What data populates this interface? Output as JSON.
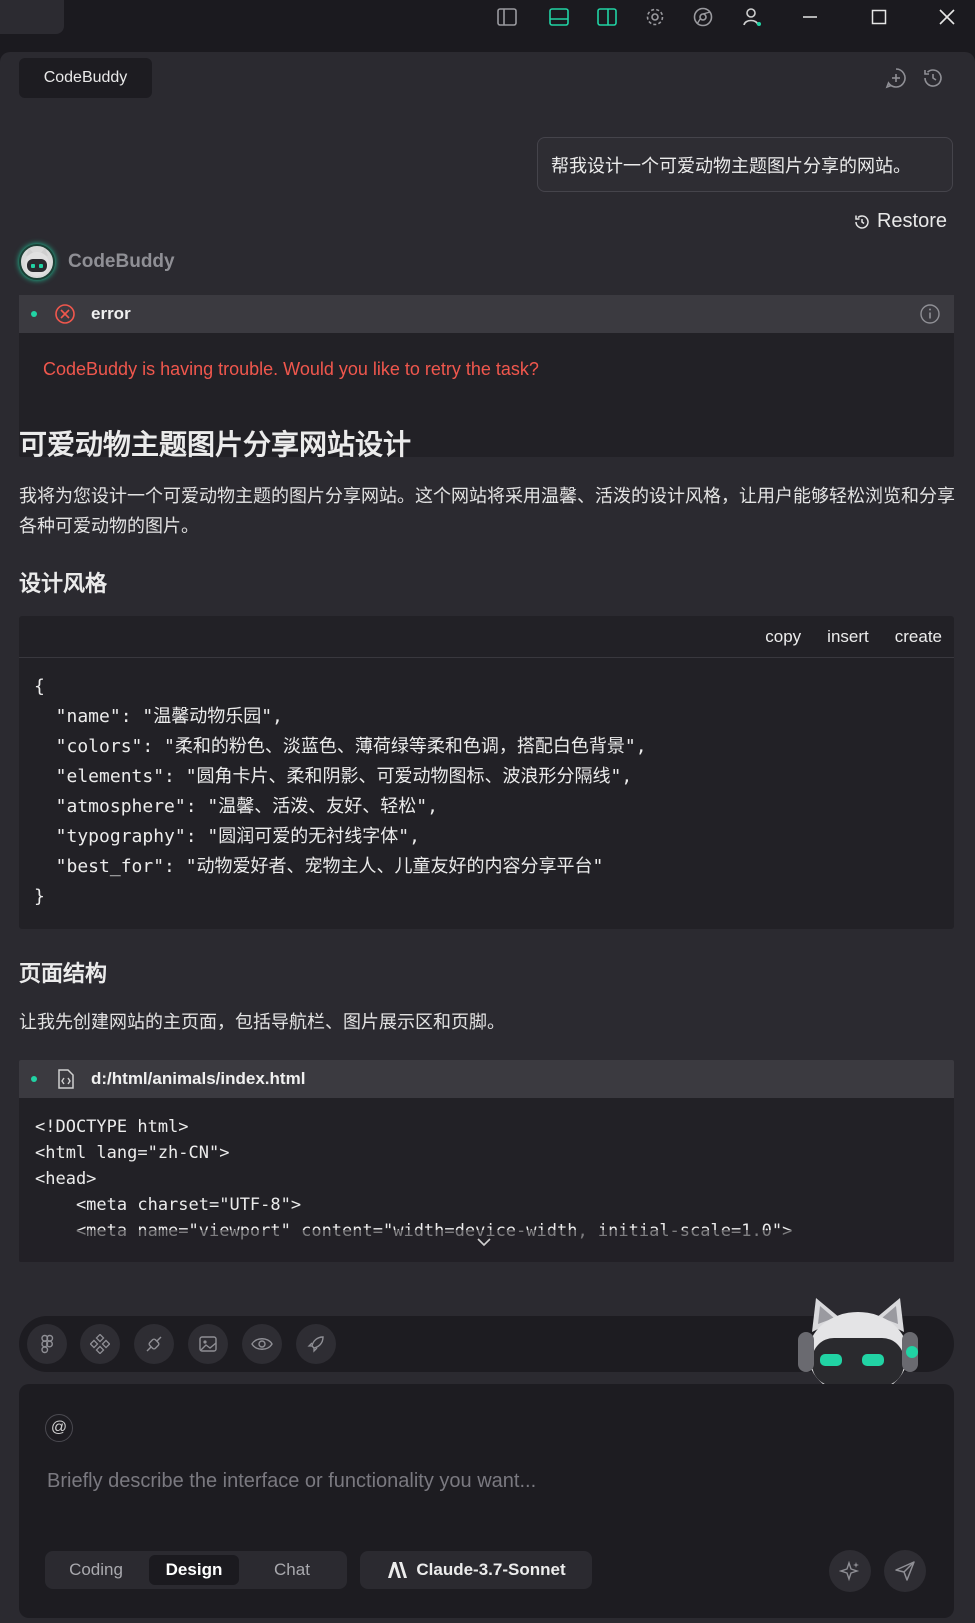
{
  "header": {
    "tab_label": "CodeBuddy"
  },
  "user_message": "帮我设计一个可爱动物主题图片分享的网站。",
  "restore_label": "Restore",
  "bot": {
    "name": "CodeBuddy"
  },
  "error": {
    "title": "error",
    "message": "CodeBuddy is having trouble. Would you like to retry the task?"
  },
  "content": {
    "h1": "可爱动物主题图片分享网站设计",
    "intro": "我将为您设计一个可爱动物主题的图片分享网站。这个网站将采用温馨、活泼的设计风格，让用户能够轻松浏览和分享各种可爱动物的图片。",
    "h2_style": "设计风格",
    "code_actions": {
      "copy": "copy",
      "insert": "insert",
      "create": "create"
    },
    "style_code": "{\n  \"name\": \"温馨动物乐园\",\n  \"colors\": \"柔和的粉色、淡蓝色、薄荷绿等柔和色调，搭配白色背景\",\n  \"elements\": \"圆角卡片、柔和阴影、可爱动物图标、波浪形分隔线\",\n  \"atmosphere\": \"温馨、活泼、友好、轻松\",\n  \"typography\": \"圆润可爱的无衬线字体\",\n  \"best_for\": \"动物爱好者、宠物主人、儿童友好的内容分享平台\"\n}",
    "h2_structure": "页面结构",
    "structure_text": "让我先创建网站的主页面，包括导航栏、图片展示区和页脚。",
    "file": {
      "path": "d:/html/animals/index.html",
      "code": "<!DOCTYPE html>\n<html lang=\"zh-CN\">\n<head>\n    <meta charset=\"UTF-8\">\n    <meta name=\"viewport\" content=\"width=device-width, initial-scale=1.0\">"
    }
  },
  "input": {
    "at_symbol": "@",
    "placeholder": "Briefly describe the interface or functionality you want...",
    "modes": [
      "Coding",
      "Design",
      "Chat"
    ],
    "active_mode": "Design",
    "model": "Claude-3.7-Sonnet"
  },
  "colors": {
    "accent": "#21d3a4",
    "error": "#f0574d",
    "background": "#1b1a1f",
    "panel": "#2b2a30"
  }
}
